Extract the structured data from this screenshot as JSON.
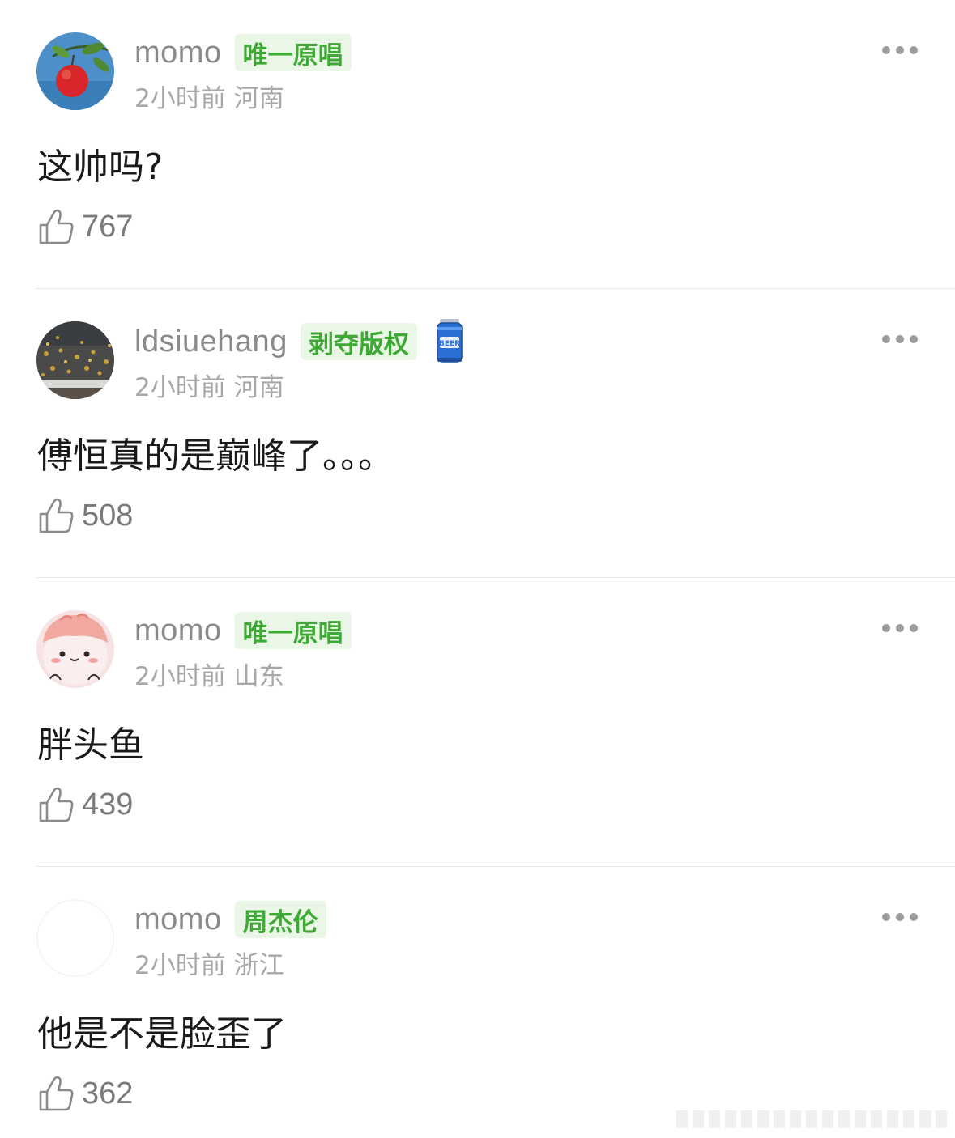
{
  "comments": [
    {
      "username": "momo",
      "badge": "唯一原唱",
      "time": "2小时前",
      "location": "河南",
      "text": "这帅吗?",
      "likes": "767",
      "avatar_icon": "apple-avatar"
    },
    {
      "username": "ldsiuehang",
      "badge": "剥夺版权",
      "time": "2小时前",
      "location": "河南",
      "text": "傅恒真的是巅峰了。。。",
      "likes": "508",
      "avatar_icon": "leaves-road-avatar",
      "extra_icon": "beer-can-icon"
    },
    {
      "username": "momo",
      "badge": "唯一原唱",
      "time": "2小时前",
      "location": "山东",
      "text": "胖头鱼",
      "likes": "439",
      "avatar_icon": "pink-cartoon-avatar"
    },
    {
      "username": "momo",
      "badge": "周杰伦",
      "time": "2小时前",
      "location": "浙江",
      "text": "他是不是脸歪了",
      "likes": "362",
      "avatar_icon": "blank-avatar"
    }
  ],
  "colors": {
    "badge_text": "#3fa935",
    "badge_bg": "#eaf7e6",
    "username": "#8a8a8a",
    "meta": "#a8a8a8"
  }
}
